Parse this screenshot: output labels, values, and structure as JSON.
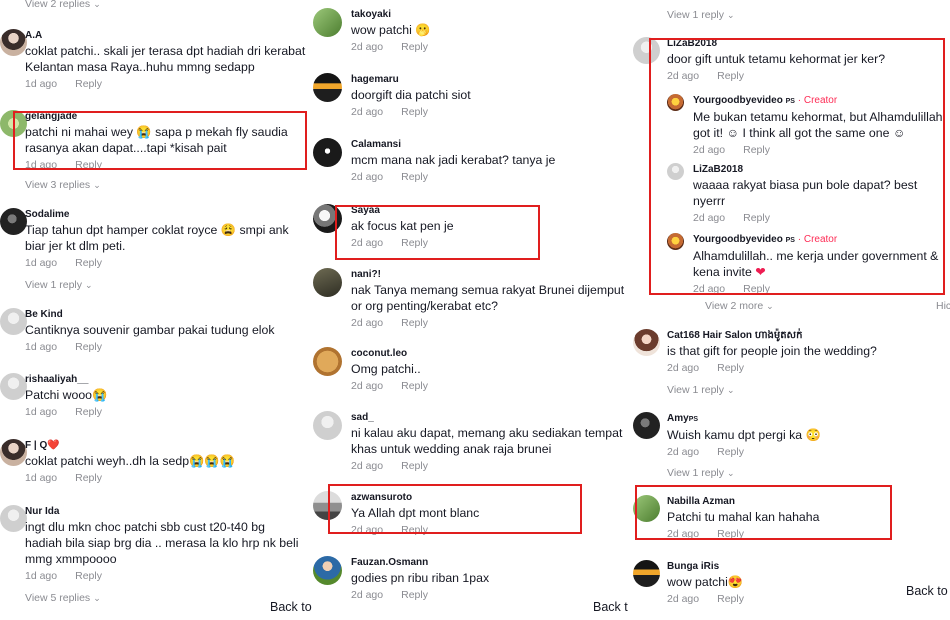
{
  "panel_1": {
    "top_view_replies": "View 2 replies",
    "comments": [
      {
        "username": "A.A",
        "text": [
          "coklat patchi.. skali jer terasa dpt hadiah dri kerabat",
          "Kelantan masa Raya..huhu mmng sedapp"
        ],
        "time": "1d ago",
        "reply": "Reply"
      },
      {
        "username": "gelangjade",
        "text": [
          "patchi ni mahai wey 😭 sapa p mekah fly saudia",
          "rasanya akan dapat....tapi *kisah pait"
        ],
        "time": "1d ago",
        "reply": "Reply",
        "view_replies": "View 3 replies"
      },
      {
        "username": "Sodalime",
        "text": [
          "Tiap tahun dpt hamper coklat royce 😩 smpi ank",
          "biar jer kt dlm peti."
        ],
        "time": "1d ago",
        "reply": "Reply",
        "view_replies": "View 1 reply"
      },
      {
        "username": "Be Kind",
        "text": [
          "Cantiknya souvenir gambar pakai tudung elok"
        ],
        "time": "1d ago",
        "reply": "Reply"
      },
      {
        "username": "rishaaliyah__",
        "text": [
          "Patchi wooo😭"
        ],
        "time": "1d ago",
        "reply": "Reply"
      },
      {
        "username": "F | Q❤️",
        "text": [
          "coklat patchi weyh..dh la sedp😭😭😭"
        ],
        "time": "1d ago",
        "reply": "Reply"
      },
      {
        "username": "Nur Ida",
        "text": [
          "ingt dlu mkn choc patchi sbb cust t20-t40 bg",
          "hadiah bila siap brg dia .. merasa la klo hrp nk beli",
          "mmg xmmpoooo"
        ],
        "time": "1d ago",
        "reply": "Reply",
        "view_replies": "View 5 replies"
      }
    ],
    "back_to_top": "Back to"
  },
  "panel_2": {
    "comments": [
      {
        "username": "takoyaki",
        "text": [
          "wow patchi 🫢"
        ],
        "time": "2d ago",
        "reply": "Reply"
      },
      {
        "username": "hagemaru",
        "text": [
          "doorgift dia patchi siot"
        ],
        "time": "2d ago",
        "reply": "Reply"
      },
      {
        "username": "Calamansi",
        "text": [
          "mcm mana nak jadi kerabat? tanya je"
        ],
        "time": "2d ago",
        "reply": "Reply"
      },
      {
        "username": "Sayaa",
        "text": [
          "ak focus kat pen je"
        ],
        "time": "2d ago",
        "reply": "Reply"
      },
      {
        "username": "nani?!",
        "text": [
          "nak Tanya memang semua rakyat Brunei dijemput",
          "or org penting/kerabat etc?"
        ],
        "time": "2d ago",
        "reply": "Reply"
      },
      {
        "username": "coconut.leo",
        "text": [
          "Omg patchi.."
        ],
        "time": "2d ago",
        "reply": "Reply"
      },
      {
        "username": "sad_",
        "text": [
          "ni kalau aku dapat, memang aku sediakan tempat",
          "khas untuk wedding anak raja brunei"
        ],
        "time": "2d ago",
        "reply": "Reply"
      },
      {
        "username": "azwansuroto",
        "text": [
          "Ya Allah dpt mont blanc"
        ],
        "time": "2d ago",
        "reply": "Reply"
      },
      {
        "username": "Fauzan.Osmann",
        "text": [
          "godies pn ribu riban 1pax"
        ],
        "time": "2d ago",
        "reply": "Reply"
      }
    ],
    "back_to_top": "Back to"
  },
  "panel_3": {
    "top_view_replies": "View 1 reply",
    "comments": [
      {
        "username": "LiZaB2018",
        "text": [
          "door gift untuk tetamu kehormat jer ker?"
        ],
        "time": "2d ago",
        "reply": "Reply"
      }
    ],
    "replies": [
      {
        "username": "Yourgoodbyevideo",
        "badge": "PS",
        "tag": "· Creator",
        "text": [
          "Me bukan tetamu kehormat, but Alhamdulillah",
          "got it! ☺ I think all got the same one ☺"
        ],
        "time": "2d ago",
        "reply": "Reply"
      },
      {
        "username": "LiZaB2018",
        "text": [
          "waaaa rakyat biasa pun bole dapat? best",
          "nyerrr"
        ],
        "time": "2d ago",
        "reply": "Reply"
      },
      {
        "username": "Yourgoodbyevideo",
        "badge": "PS",
        "tag": "· Creator",
        "text": [
          "Alhamdulillah.. me kerja under government &",
          "kena invite"
        ],
        "heart": "❤",
        "time": "2d ago",
        "reply": "Reply"
      }
    ],
    "view_more": "View 2 more",
    "hide_partial": "Hic",
    "comments_after": [
      {
        "username": "Cat168 Hair Salon ហាងម៉ូតសក់",
        "text": [
          "is that gift for people join the wedding?"
        ],
        "time": "2d ago",
        "reply": "Reply",
        "view_replies": "View 1 reply"
      },
      {
        "username": "Amy",
        "badge": "PS",
        "text": [
          "Wuish kamu dpt pergi ka 😳"
        ],
        "time": "2d ago",
        "reply": "Reply",
        "view_replies": "View 1 reply"
      },
      {
        "username": "Nabilla Azman",
        "text": [
          "Patchi tu mahal kan hahaha"
        ],
        "time": "2d ago",
        "reply": "Reply"
      },
      {
        "username": "Bunga iRis",
        "text": [
          "wow patchi😍"
        ],
        "time": "2d ago",
        "reply": "Reply"
      }
    ],
    "back_to_top": "Back to"
  }
}
